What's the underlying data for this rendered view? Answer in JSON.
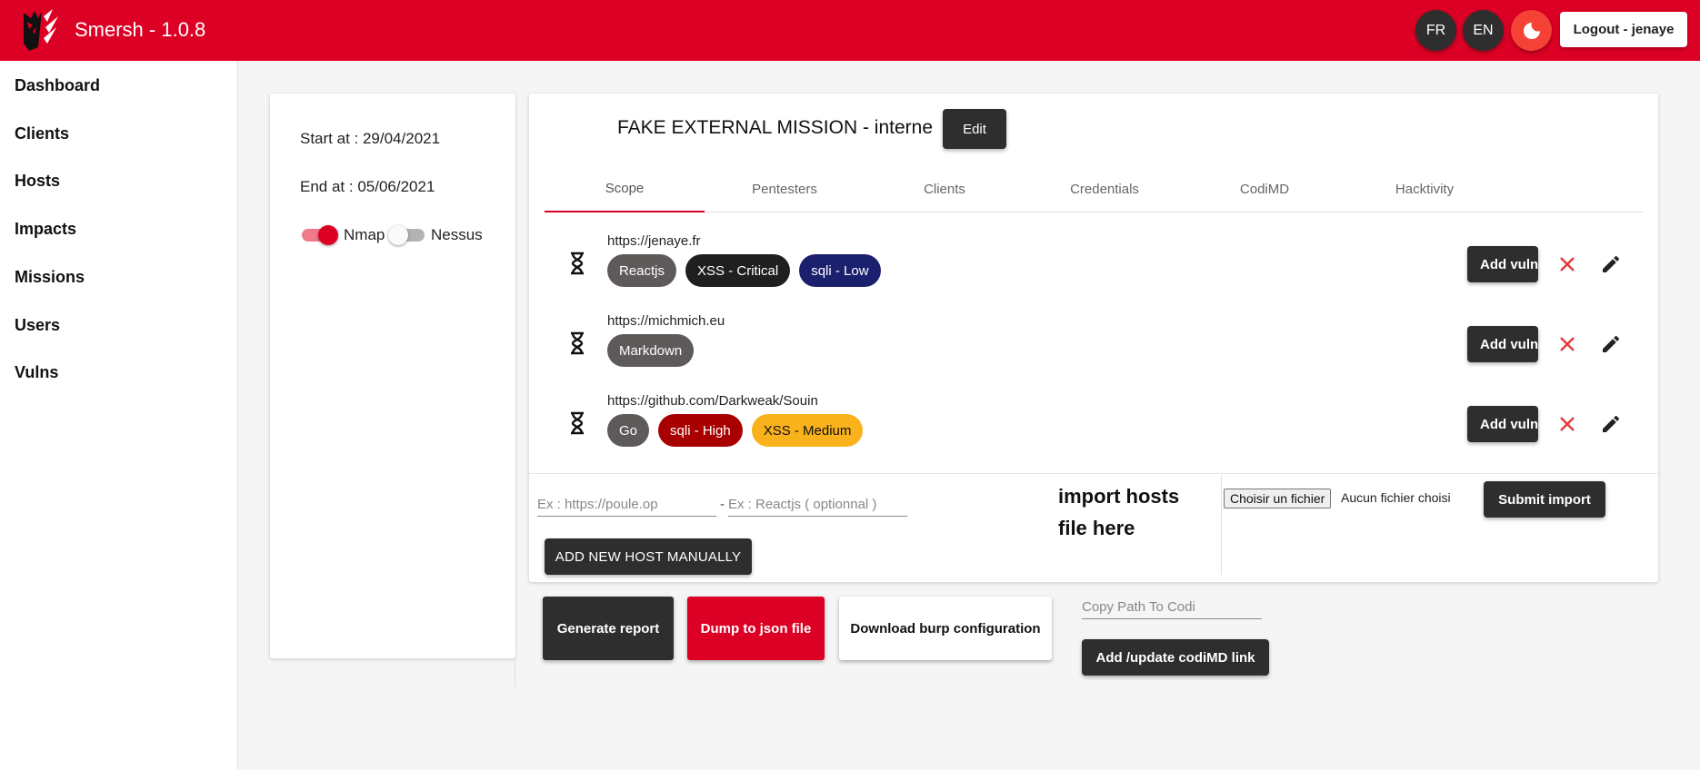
{
  "app": {
    "title": "Smersh - 1.0.8"
  },
  "header": {
    "lang_fr": "FR",
    "lang_en": "EN",
    "theme_icon": "moon-icon",
    "logout_label": "Logout - jenaye"
  },
  "sidebar": {
    "items": [
      {
        "label": "Dashboard"
      },
      {
        "label": "Clients"
      },
      {
        "label": "Hosts"
      },
      {
        "label": "Impacts"
      },
      {
        "label": "Missions"
      },
      {
        "label": "Users"
      },
      {
        "label": "Vulns"
      }
    ]
  },
  "mission_info": {
    "start": "Start at : 29/04/2021",
    "end": "End at : 05/06/2021",
    "nmap_label": "Nmap",
    "nmap_on": true,
    "nessus_label": "Nessus",
    "nessus_on": false
  },
  "mission": {
    "title": "FAKE EXTERNAL MISSION - interne",
    "edit_label": "Edit"
  },
  "tabs": [
    {
      "label": "Scope",
      "active": true
    },
    {
      "label": "Pentesters",
      "active": false
    },
    {
      "label": "Clients",
      "active": false
    },
    {
      "label": "Credentials",
      "active": false
    },
    {
      "label": "CodiMD",
      "active": false
    },
    {
      "label": "Hacktivity",
      "active": false
    }
  ],
  "hosts": [
    {
      "url": "https://jenaye.fr",
      "chips": [
        {
          "label": "Reactjs",
          "color": "#5f5a5a"
        },
        {
          "label": "XSS - Critical",
          "color": "#1f1f1f"
        },
        {
          "label": "sqli - Low",
          "color": "#1a1f6e"
        }
      ]
    },
    {
      "url": "https://michmich.eu",
      "chips": [
        {
          "label": "Markdown",
          "color": "#5f5a5a"
        }
      ]
    },
    {
      "url": "https://github.com/Darkweak/Souin",
      "chips": [
        {
          "label": "Go",
          "color": "#5f5a5a"
        },
        {
          "label": "sqli - High",
          "color": "#a80000"
        },
        {
          "label": "XSS - Medium",
          "color": "#f9b21b",
          "text_color": "#111111"
        }
      ]
    }
  ],
  "host_actions": {
    "add_vuln_label": "Add vuln"
  },
  "add_host": {
    "url_placeholder": "Ex : https://poule.op",
    "tech_placeholder": "Ex : Reactjs ( optionnal )",
    "separator": "-",
    "button_label": "ADD NEW HOST MANUALLY"
  },
  "import": {
    "label": "import hosts file here",
    "file_button": "Choisir un fichier",
    "file_none": "Aucun fichier choisi",
    "submit_label": "Submit import"
  },
  "actions": {
    "generate_report": "Generate report",
    "dump_json": "Dump to json file",
    "download_burp": "Download burp configuration",
    "codi_placeholder": "Copy Path To Codi",
    "codi_button": "Add /update codiMD link"
  },
  "colors": {
    "brand": "#dc0024",
    "dark_button": "#2e2e2e",
    "delete": "#e53935"
  }
}
